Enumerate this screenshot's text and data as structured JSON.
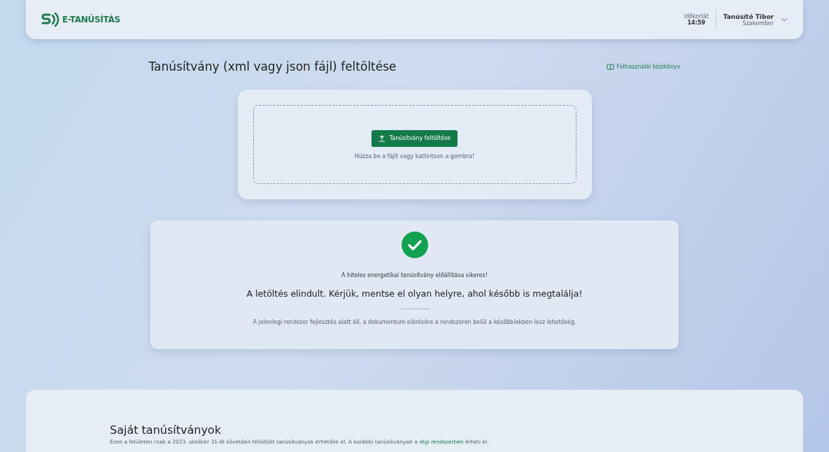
{
  "header": {
    "logo_text": "E-TANÚSÍTÁS",
    "time_limit_label": "időkorlát",
    "time_limit_value": "14:59",
    "user_name": "Tanúsító Tibor",
    "user_role": "Szakember"
  },
  "upload": {
    "title": "Tanúsítvány (xml vagy json fájl) feltöltése",
    "manual_link": "Felhasználói kézikönyv",
    "button": "Tanúsítvány feltöltése",
    "hint": "Húzza be a fájlt vagy kattintson a gombra!"
  },
  "success": {
    "headline": "A hiteles energetikai tanúsítvány előállítása sikeres!",
    "message": "A letöltés elindult. Kérjük, mentse el olyan helyre, ahol később is megtalálja!",
    "note": "A jelenlegi rendszer fejlesztés alatt áll, a dokumentum elérésére a rendszeren belül a későbbiekben lesz lehetőség."
  },
  "own_certificates": {
    "title": "Saját tanúsítványok",
    "text_before": "Ezen a felületen csak a 2023. október 31-ét követően feltöltött tanúsítványok érhetőek el. A korábbi tanúsítványait a",
    "link": "régi rendszerben",
    "text_after": "érheti el."
  }
}
